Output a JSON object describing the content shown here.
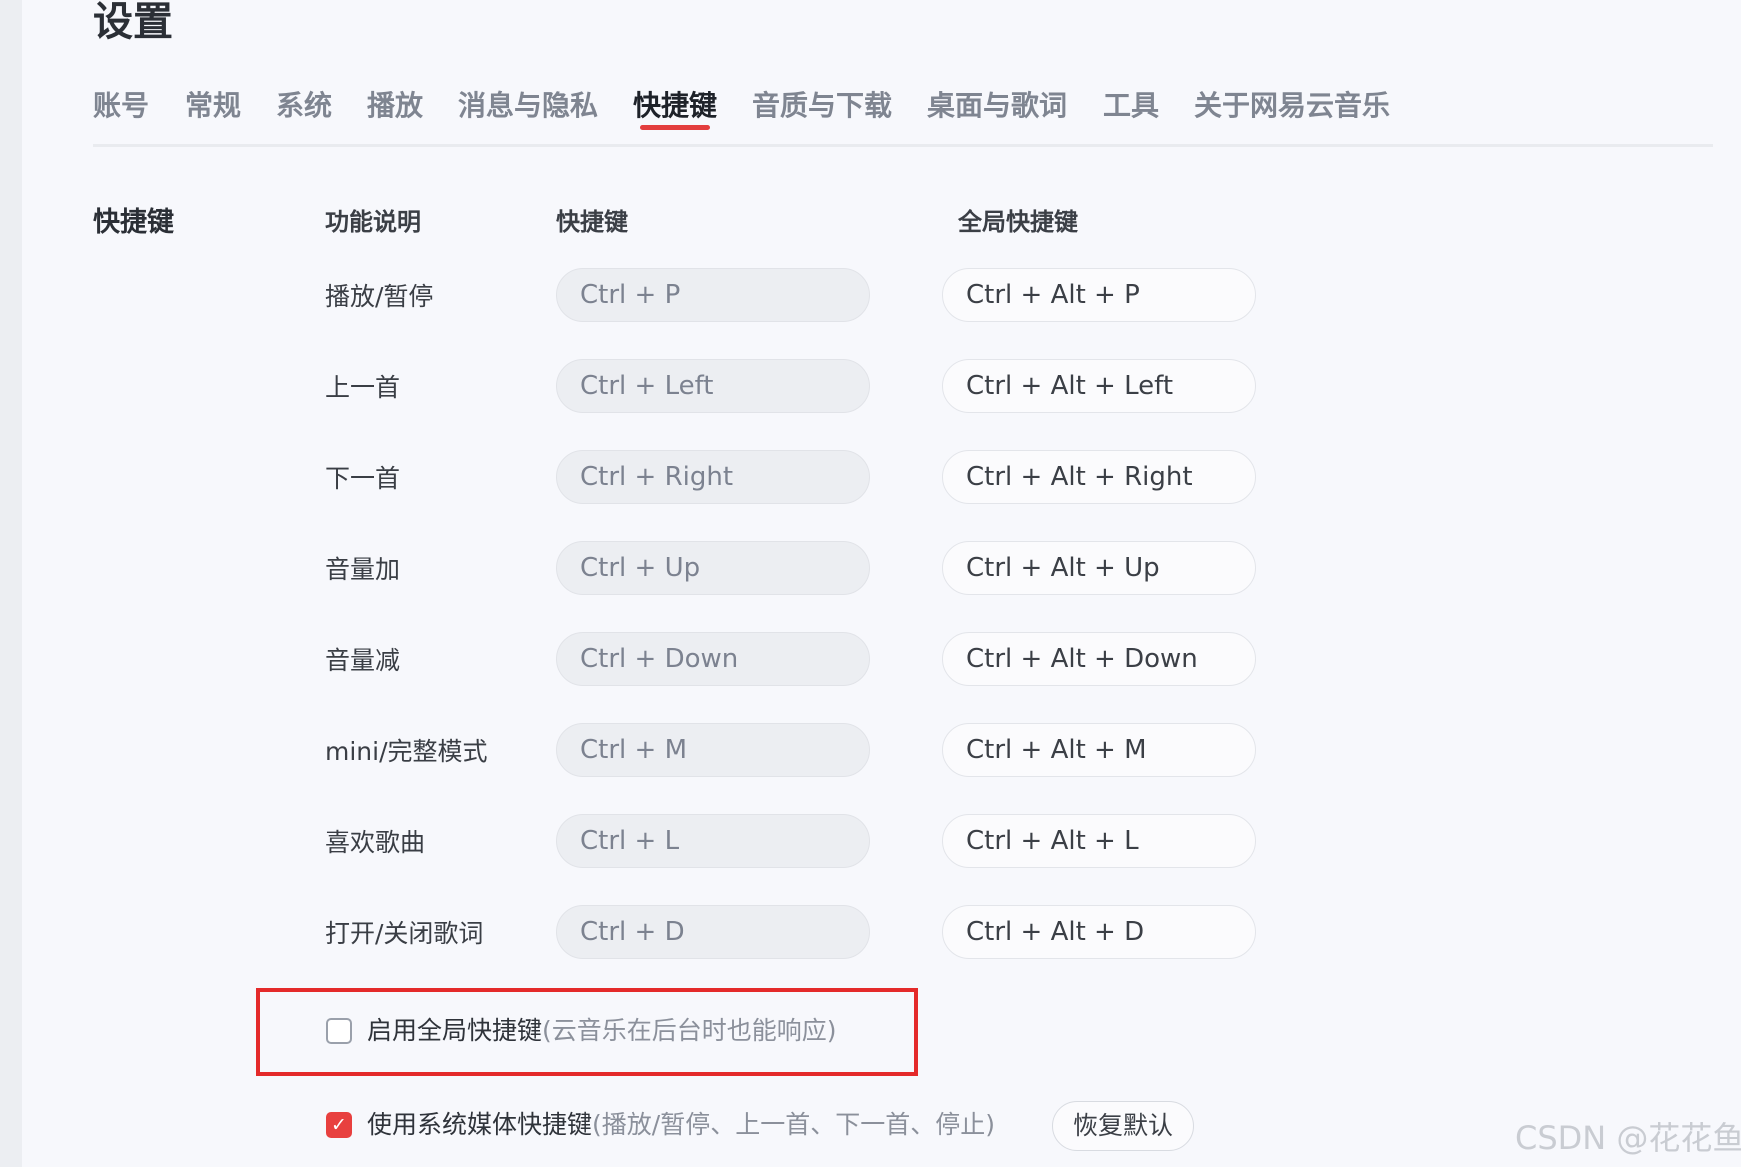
{
  "header": {
    "title": "设置"
  },
  "tabs": [
    {
      "label": "账号"
    },
    {
      "label": "常规"
    },
    {
      "label": "系统"
    },
    {
      "label": "播放"
    },
    {
      "label": "消息与隐私"
    },
    {
      "label": "快捷键",
      "active": true
    },
    {
      "label": "音质与下载"
    },
    {
      "label": "桌面与歌词"
    },
    {
      "label": "工具"
    },
    {
      "label": "关于网易云音乐"
    }
  ],
  "shortcuts": {
    "section_label": "快捷键",
    "headers": {
      "desc": "功能说明",
      "local": "快捷键",
      "global": "全局快捷键"
    },
    "rows": [
      {
        "desc": "播放/暂停",
        "local": "Ctrl + P",
        "global": "Ctrl + Alt + P"
      },
      {
        "desc": "上一首",
        "local": "Ctrl + Left",
        "global": "Ctrl + Alt + Left"
      },
      {
        "desc": "下一首",
        "local": "Ctrl + Right",
        "global": "Ctrl + Alt + Right"
      },
      {
        "desc": "音量加",
        "local": "Ctrl + Up",
        "global": "Ctrl + Alt + Up"
      },
      {
        "desc": "音量减",
        "local": "Ctrl + Down",
        "global": "Ctrl + Alt + Down"
      },
      {
        "desc": "mini/完整模式",
        "local": "Ctrl + M",
        "global": "Ctrl + Alt + M"
      },
      {
        "desc": "喜欢歌曲",
        "local": "Ctrl + L",
        "global": "Ctrl + Alt + L"
      },
      {
        "desc": "打开/关闭歌词",
        "local": "Ctrl + D",
        "global": "Ctrl + Alt + D"
      }
    ]
  },
  "options": {
    "global_enable": {
      "label": "启用全局快捷键",
      "hint": "(云音乐在后台时也能响应)",
      "checked": false
    },
    "media_keys": {
      "label": "使用系统媒体快捷键",
      "hint": "(播放/暂停、上一首、下一首、停止)",
      "checked": true,
      "check_glyph": "✓"
    },
    "reset_label": "恢复默认"
  },
  "colors": {
    "accent": "#e33e3e",
    "highlight_box": "#e42a2a"
  },
  "watermark": "CSDN @花花鱼"
}
